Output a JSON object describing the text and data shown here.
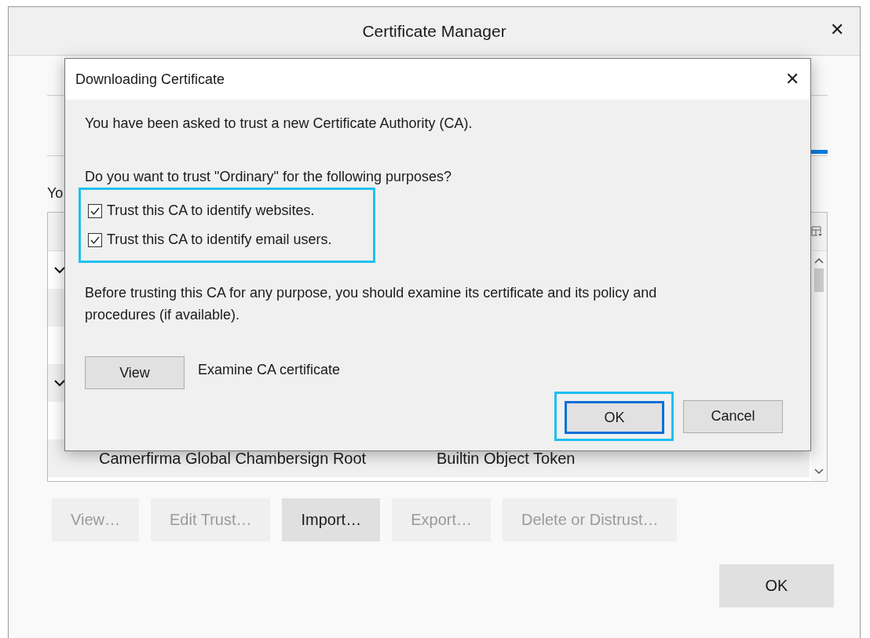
{
  "window": {
    "title": "Certificate Manager",
    "close": "✕"
  },
  "intro_partial": "Yo",
  "tree": {
    "rows": [
      {
        "kind": "group",
        "expanded": true
      },
      {
        "kind": "item"
      },
      {
        "kind": "item"
      },
      {
        "kind": "group",
        "expanded": true
      },
      {
        "kind": "item"
      },
      {
        "kind": "item",
        "cells": [
          "Camerfirma Global Chambersign Root",
          "Builtin Object Token"
        ]
      }
    ]
  },
  "actions": [
    {
      "label": "View…",
      "disabled": true
    },
    {
      "label": "Edit Trust…",
      "disabled": true
    },
    {
      "label": "Import…",
      "disabled": false
    },
    {
      "label": "Export…",
      "disabled": true
    },
    {
      "label": "Delete or Distrust…",
      "disabled": true
    }
  ],
  "ok_button": "OK",
  "dialog": {
    "title": "Downloading Certificate",
    "close": "✕",
    "message": "You have been asked to trust a new Certificate Authority (CA).",
    "question": "Do you want to trust \"Ordinary\" for the following purposes?",
    "purposes_focused": true,
    "purposes": [
      {
        "label": "Trust this CA to identify websites.",
        "checked": true
      },
      {
        "label": "Trust this CA to identify email users.",
        "checked": true
      }
    ],
    "advice": "Before trusting this CA for any purpose, you should examine its certificate and its policy and procedures (if available).",
    "view_button": "View",
    "view_label": "Examine CA certificate",
    "buttons": [
      {
        "label": "OK",
        "focused": true
      },
      {
        "label": "Cancel",
        "focused": false
      }
    ]
  }
}
